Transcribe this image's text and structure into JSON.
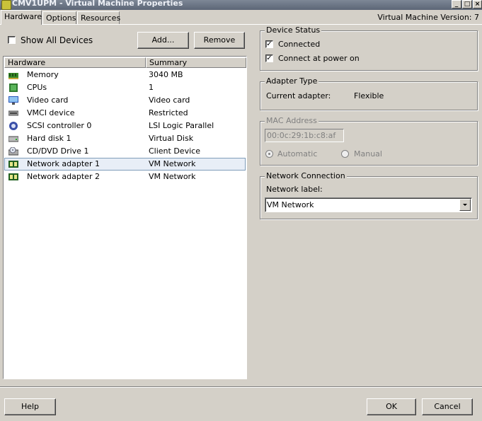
{
  "window": {
    "title": "CMV1UPM - Virtual Machine Properties"
  },
  "tabs": [
    {
      "label": "Hardware"
    },
    {
      "label": "Options"
    },
    {
      "label": "Resources"
    }
  ],
  "version_label": "Virtual Machine Version: 7",
  "show_all_devices": {
    "label": "Show All Devices",
    "checked": false
  },
  "buttons": {
    "add": "Add...",
    "remove": "Remove",
    "help": "Help",
    "ok": "OK",
    "cancel": "Cancel"
  },
  "hardware_table": {
    "columns": [
      "Hardware",
      "Summary"
    ],
    "rows": [
      {
        "icon": "memory-icon",
        "name": "Memory",
        "summary": "3040 MB"
      },
      {
        "icon": "cpu-icon",
        "name": "CPUs",
        "summary": "1"
      },
      {
        "icon": "monitor-icon",
        "name": "Video card",
        "summary": "Video card"
      },
      {
        "icon": "vmci-icon",
        "name": "VMCI device",
        "summary": "Restricted"
      },
      {
        "icon": "scsi-controller-icon",
        "name": "SCSI controller 0",
        "summary": "LSI Logic Parallel"
      },
      {
        "icon": "hard-disk-icon",
        "name": "Hard disk 1",
        "summary": "Virtual Disk"
      },
      {
        "icon": "cd-drive-icon",
        "name": "CD/DVD Drive 1",
        "summary": "Client Device"
      },
      {
        "icon": "network-adapter-icon",
        "name": "Network adapter 1",
        "summary": "VM Network",
        "selected": true
      },
      {
        "icon": "network-adapter-icon",
        "name": "Network adapter 2",
        "summary": "VM Network"
      }
    ]
  },
  "device_status": {
    "title": "Device Status",
    "connected": {
      "label": "Connected",
      "checked": true
    },
    "connect_at_power_on": {
      "label": "Connect at power on",
      "checked": true
    }
  },
  "adapter_type": {
    "title": "Adapter Type",
    "label": "Current adapter:",
    "value": "Flexible"
  },
  "mac_address": {
    "title": "MAC Address",
    "value": "00:0c:29:1b:c8:af",
    "automatic": "Automatic",
    "manual": "Manual",
    "selected": "Automatic"
  },
  "network_connection": {
    "title": "Network Connection",
    "label": "Network label:",
    "selected": "VM Network"
  }
}
